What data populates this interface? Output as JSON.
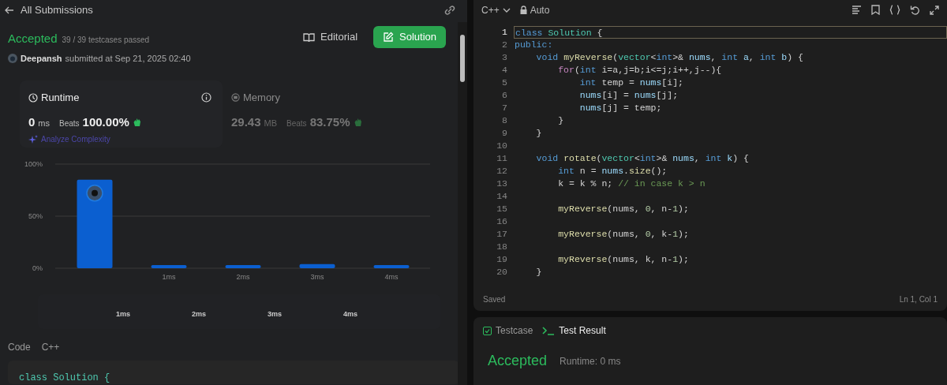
{
  "header": {
    "back_label": "All Submissions"
  },
  "submission": {
    "status": "Accepted",
    "testcases": "39 / 39 testcases passed",
    "user": "Deepansh",
    "submitted": "submitted at Sep 21, 2025 02:40"
  },
  "actions": [
    {
      "label": "Editorial",
      "kind": "plain"
    },
    {
      "label": "Solution",
      "kind": "primary"
    }
  ],
  "stats": [
    {
      "title": "Runtime",
      "value": "0",
      "unit": "ms",
      "beats_label": "Beats",
      "beats": "100.00%",
      "selected": true
    },
    {
      "title": "Memory",
      "value": "29.43",
      "unit": "MB",
      "beats_label": "Beats",
      "beats": "83.75%",
      "selected": false
    }
  ],
  "analyze_link": "Analyze Complexity",
  "chart_data": {
    "type": "bar",
    "categories": [
      null,
      "1ms",
      "2ms",
      "3ms",
      "4ms"
    ],
    "values": [
      85,
      3,
      3,
      4,
      3
    ],
    "ylim": [
      0,
      100
    ],
    "yticks": [
      {
        "value": 0,
        "label": "0%"
      },
      {
        "value": 50,
        "label": "50%"
      },
      {
        "value": 100,
        "label": "100%"
      }
    ]
  },
  "range_labels": [
    "1ms",
    "2ms",
    "3ms",
    "4ms"
  ],
  "code_section": {
    "label": "Code",
    "language": "C++",
    "first_line": "class Solution {"
  },
  "editor": {
    "language": "C++",
    "mode": "Auto",
    "status": "Saved",
    "cursor": "Ln 1, Col 1",
    "lines": [
      {
        "number": "1",
        "tokens": [
          {
            "kind": "kw",
            "text": "class "
          },
          {
            "kind": "type",
            "text": "Solution"
          },
          {
            "kind": "plain",
            "text": " {"
          }
        ]
      },
      {
        "number": "2",
        "tokens": [
          {
            "kind": "kw",
            "text": "public:"
          }
        ]
      },
      {
        "number": "3",
        "tokens": [
          {
            "kind": "kw",
            "text": "    void "
          },
          {
            "kind": "fn",
            "text": "myReverse"
          },
          {
            "kind": "plain",
            "text": "("
          },
          {
            "kind": "type",
            "text": "vector"
          },
          {
            "kind": "plain",
            "text": "<"
          },
          {
            "kind": "kw",
            "text": "int"
          },
          {
            "kind": "plain",
            "text": ">& "
          },
          {
            "kind": "var",
            "text": "nums"
          },
          {
            "kind": "plain",
            "text": ", "
          },
          {
            "kind": "kw",
            "text": "int "
          },
          {
            "kind": "var",
            "text": "a"
          },
          {
            "kind": "plain",
            "text": ", "
          },
          {
            "kind": "kw",
            "text": "int "
          },
          {
            "kind": "var",
            "text": "b"
          },
          {
            "kind": "plain",
            "text": ") {"
          }
        ]
      },
      {
        "number": "4",
        "tokens": [
          {
            "kind": "ctrl",
            "text": "        for"
          },
          {
            "kind": "plain",
            "text": "("
          },
          {
            "kind": "kw",
            "text": "int "
          },
          {
            "kind": "plain",
            "text": "i=a,j=b;i<=j;i++,j--){"
          }
        ]
      },
      {
        "number": "5",
        "tokens": [
          {
            "kind": "kw",
            "text": "            int "
          },
          {
            "kind": "plain",
            "text": "temp = "
          },
          {
            "kind": "var",
            "text": "nums"
          },
          {
            "kind": "plain",
            "text": "[i];"
          }
        ]
      },
      {
        "number": "6",
        "tokens": [
          {
            "kind": "var",
            "text": "            nums"
          },
          {
            "kind": "plain",
            "text": "[i] = "
          },
          {
            "kind": "var",
            "text": "nums"
          },
          {
            "kind": "plain",
            "text": "[j];"
          }
        ]
      },
      {
        "number": "7",
        "tokens": [
          {
            "kind": "var",
            "text": "            nums"
          },
          {
            "kind": "plain",
            "text": "[j] = temp;"
          }
        ]
      },
      {
        "number": "8",
        "tokens": [
          {
            "kind": "plain",
            "text": "        }"
          }
        ]
      },
      {
        "number": "9",
        "tokens": [
          {
            "kind": "plain",
            "text": "    }"
          }
        ]
      },
      {
        "number": "10"
      },
      {
        "number": "11",
        "tokens": [
          {
            "kind": "kw",
            "text": "    void "
          },
          {
            "kind": "fn",
            "text": "rotate"
          },
          {
            "kind": "plain",
            "text": "("
          },
          {
            "kind": "type",
            "text": "vector"
          },
          {
            "kind": "plain",
            "text": "<"
          },
          {
            "kind": "kw",
            "text": "int"
          },
          {
            "kind": "plain",
            "text": ">& "
          },
          {
            "kind": "var",
            "text": "nums"
          },
          {
            "kind": "plain",
            "text": ", "
          },
          {
            "kind": "kw",
            "text": "int "
          },
          {
            "kind": "var",
            "text": "k"
          },
          {
            "kind": "plain",
            "text": ") {"
          }
        ]
      },
      {
        "number": "12",
        "tokens": [
          {
            "kind": "kw",
            "text": "        int "
          },
          {
            "kind": "plain",
            "text": "n = "
          },
          {
            "kind": "var",
            "text": "nums"
          },
          {
            "kind": "plain",
            "text": "."
          },
          {
            "kind": "fn",
            "text": "size"
          },
          {
            "kind": "plain",
            "text": "();"
          }
        ]
      },
      {
        "number": "13",
        "tokens": [
          {
            "kind": "plain",
            "text": "        k = k % n; "
          },
          {
            "kind": "comment",
            "text": "// in case k > n"
          }
        ]
      },
      {
        "number": "14"
      },
      {
        "number": "15",
        "tokens": [
          {
            "kind": "fn",
            "text": "        myReverse"
          },
          {
            "kind": "plain",
            "text": "(nums, "
          },
          {
            "kind": "num",
            "text": "0"
          },
          {
            "kind": "plain",
            "text": ", n-"
          },
          {
            "kind": "num",
            "text": "1"
          },
          {
            "kind": "plain",
            "text": ");"
          }
        ]
      },
      {
        "number": "16"
      },
      {
        "number": "17",
        "tokens": [
          {
            "kind": "fn",
            "text": "        myReverse"
          },
          {
            "kind": "plain",
            "text": "(nums, "
          },
          {
            "kind": "num",
            "text": "0"
          },
          {
            "kind": "plain",
            "text": ", k-"
          },
          {
            "kind": "num",
            "text": "1"
          },
          {
            "kind": "plain",
            "text": ");"
          }
        ]
      },
      {
        "number": "18"
      },
      {
        "number": "19",
        "tokens": [
          {
            "kind": "fn",
            "text": "        myReverse"
          },
          {
            "kind": "plain",
            "text": "(nums, k, n-"
          },
          {
            "kind": "num",
            "text": "1"
          },
          {
            "kind": "plain",
            "text": ");"
          }
        ]
      },
      {
        "number": "20",
        "tokens": [
          {
            "kind": "plain",
            "text": "    }"
          }
        ]
      }
    ]
  },
  "result_tabs": [
    {
      "label": "Testcase",
      "kind": "check",
      "selected": false
    },
    {
      "label": "Test Result",
      "kind": "terminal",
      "selected": true
    }
  ],
  "result": {
    "status": "Accepted",
    "runtime": "Runtime: 0 ms"
  }
}
